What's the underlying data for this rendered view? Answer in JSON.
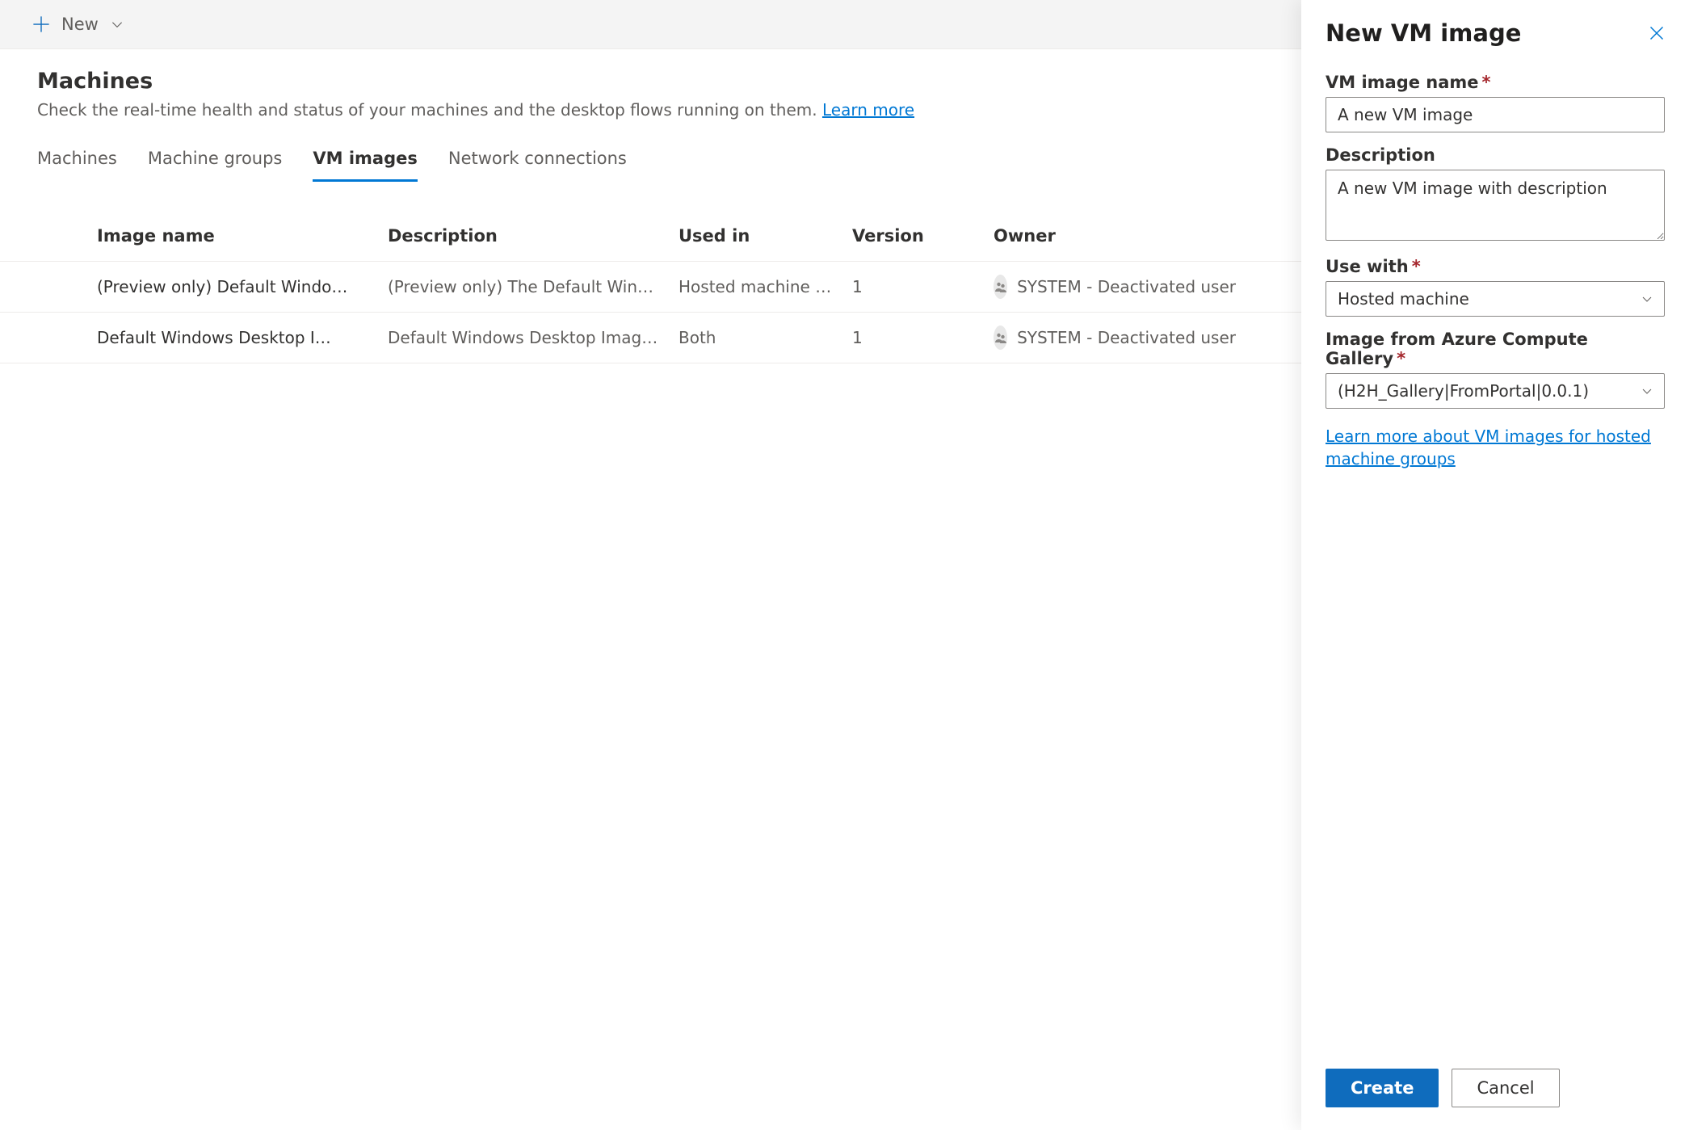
{
  "commandbar": {
    "new_label": "New"
  },
  "page": {
    "title": "Machines",
    "subtitle_prefix": "Check the real-time health and status of your machines and the desktop flows running on them. ",
    "learn_more": "Learn more"
  },
  "tabs": [
    {
      "label": "Machines",
      "active": false
    },
    {
      "label": "Machine groups",
      "active": false
    },
    {
      "label": "VM images",
      "active": true
    },
    {
      "label": "Network connections",
      "active": false
    }
  ],
  "table": {
    "headers": {
      "image_name": "Image name",
      "description": "Description",
      "used_in": "Used in",
      "version": "Version",
      "owner": "Owner"
    },
    "rows": [
      {
        "image_name": "(Preview only) Default Windo…",
        "description": "(Preview only) The Default Windows Desk…",
        "used_in": "Hosted machine group",
        "version": "1",
        "owner": "SYSTEM - Deactivated user"
      },
      {
        "image_name": "Default Windows Desktop I…",
        "description": "Default Windows Desktop Image for use i…",
        "used_in": "Both",
        "version": "1",
        "owner": "SYSTEM - Deactivated user"
      }
    ]
  },
  "panel": {
    "title": "New VM image",
    "fields": {
      "name_label": "VM image name",
      "name_value": "A new VM image",
      "desc_label": "Description",
      "desc_value": "A new VM image with description",
      "usewith_label": "Use with",
      "usewith_value": "Hosted machine",
      "gallery_label": "Image from Azure Compute Gallery",
      "gallery_value": "(H2H_Gallery|FromPortal|0.0.1)"
    },
    "link": "Learn more about VM images for hosted machine groups",
    "buttons": {
      "create": "Create",
      "cancel": "Cancel"
    }
  }
}
